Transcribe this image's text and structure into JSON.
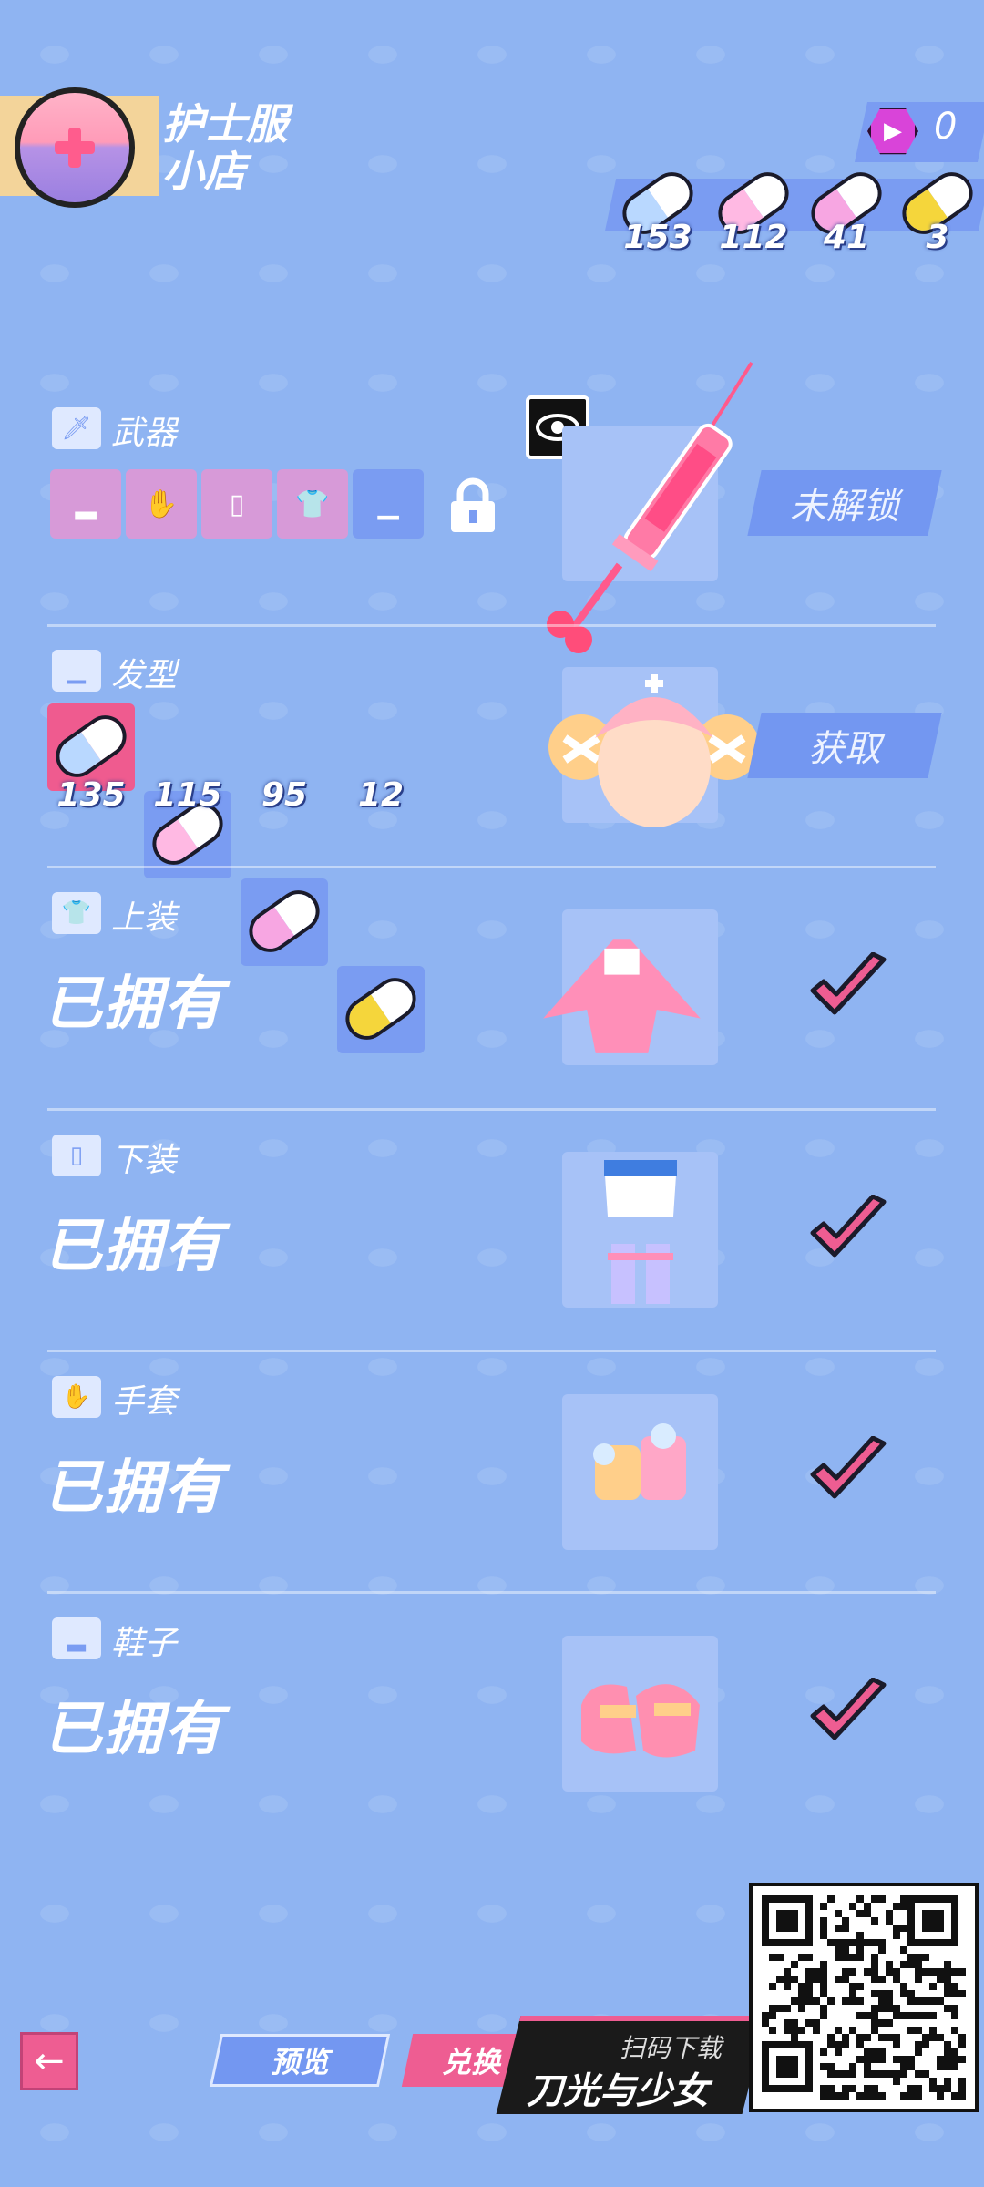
{
  "shop": {
    "title_line1": "护士服",
    "title_line2": "小店"
  },
  "currency": {
    "gem_count": "0"
  },
  "pills": [
    {
      "count": "153",
      "left": "#b9d8ff",
      "color_name": "blue"
    },
    {
      "count": "112",
      "left": "#ffb9e3",
      "color_name": "pink"
    },
    {
      "count": "41",
      "left": "#f7a6e2",
      "color_name": "pink-blue"
    },
    {
      "count": "3",
      "left": "#f5d63b",
      "color_name": "yellow"
    }
  ],
  "sections": {
    "weapon": {
      "label": "武器",
      "action": "未解锁",
      "icon": "sword-icon",
      "preview": "syringe-weapon-image"
    },
    "hair": {
      "label": "发型",
      "action": "获取",
      "icon": "hat-icon",
      "preview": "nurse-hair-image",
      "costs": [
        {
          "count": "135",
          "color": "#b9d8ff"
        },
        {
          "count": "115",
          "color": "#ffb9e3"
        },
        {
          "count": "95",
          "color": "#f7a6e2"
        },
        {
          "count": "12",
          "color": "#f5d63b"
        }
      ]
    },
    "top": {
      "label": "上装",
      "status": "已拥有",
      "icon": "shirt-icon",
      "preview": "nurse-top-image"
    },
    "bottom": {
      "label": "下装",
      "status": "已拥有",
      "icon": "shorts-icon",
      "preview": "nurse-bottom-image"
    },
    "gloves": {
      "label": "手套",
      "status": "已拥有",
      "icon": "glove-icon",
      "preview": "nurse-gloves-image"
    },
    "shoes": {
      "label": "鞋子",
      "status": "已拥有",
      "icon": "shoe-icon",
      "preview": "nurse-shoes-image"
    }
  },
  "buttons": {
    "preview": "预览",
    "exchange": "兑换"
  },
  "promo": {
    "scan": "扫码下载",
    "game": "刀光与少女"
  },
  "colors": {
    "background": "#8fb4f2",
    "accent_pink": "#ee5d92",
    "accent_blue": "#7397f1"
  }
}
